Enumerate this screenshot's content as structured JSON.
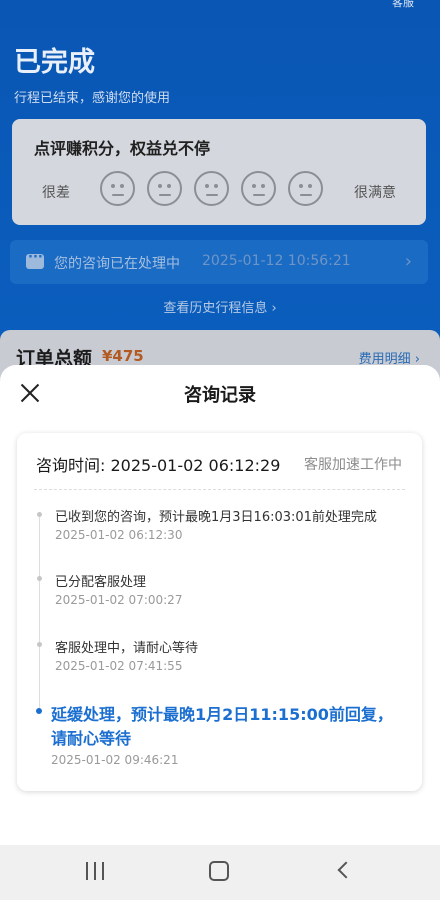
{
  "background": {
    "top_right_label": "客服",
    "status_title": "已完成",
    "status_subtitle": "行程已结束，感谢您的使用",
    "rating": {
      "title": "点评赚积分，权益兑不停",
      "low_label": "很差",
      "high_label": "很满意",
      "faces": [
        "face-1",
        "face-2",
        "face-3",
        "face-4",
        "face-5"
      ]
    },
    "consult_bar": {
      "text": "您的咨询已在处理中",
      "time": "2025-01-12 10:56:21",
      "arrow": "›"
    },
    "history_link": "查看历史行程信息 ›",
    "order": {
      "title": "订单总额",
      "amount": "¥475",
      "detail_link": "费用明细 ›"
    }
  },
  "sheet": {
    "title": "咨询记录",
    "record": {
      "time_label": "咨询时间: 2025-01-02 06:12:29",
      "status": "客服加速工作中",
      "events": [
        {
          "text": "已收到您的咨询，预计最晚1月3日16:03:01前处理完成",
          "date": "2025-01-02 06:12:30",
          "active": false
        },
        {
          "text": "已分配客服处理",
          "date": "2025-01-02 07:00:27",
          "active": false
        },
        {
          "text": "客服处理中，请耐心等待",
          "date": "2025-01-02 07:41:55",
          "active": false
        },
        {
          "text": "延缓处理，预计最晚1月2日11:15:00前回复，请耐心等待",
          "date": "2025-01-02 09:46:21",
          "active": true
        }
      ]
    }
  },
  "navbar": {
    "buttons": [
      "recent-apps",
      "home",
      "back"
    ]
  },
  "colors": {
    "accent": "#1b6fd0",
    "background_blue": "#0b5fbf",
    "amount": "#b35a22"
  }
}
